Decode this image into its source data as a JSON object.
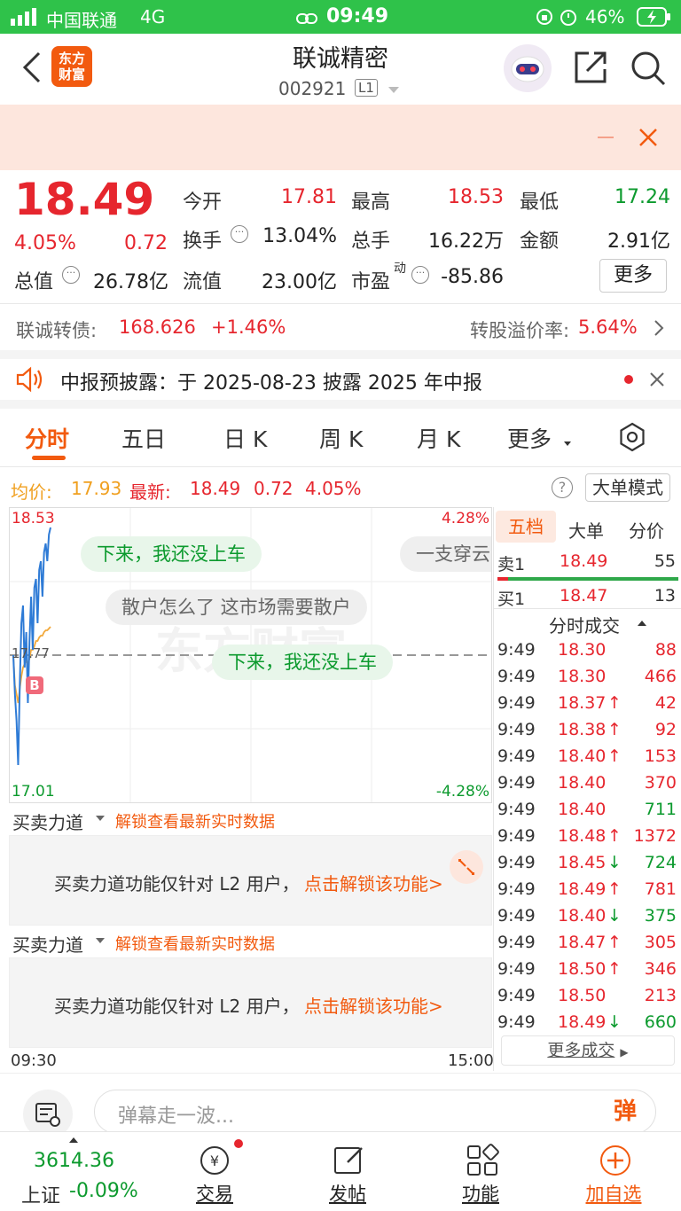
{
  "status": {
    "carrier": "中国联通",
    "network": "4G",
    "time": "09:49",
    "battery": "46%"
  },
  "nav": {
    "title": "联诚精密",
    "code": "002921",
    "level": "L1",
    "logo_line1": "东方",
    "logo_line2": "财富"
  },
  "quote": {
    "price": "18.49",
    "pct": "4.05%",
    "chg": "0.72",
    "row1": [
      {
        "label": "今开",
        "value": "17.81",
        "color": "red"
      },
      {
        "label": "最高",
        "value": "18.53",
        "color": "red"
      },
      {
        "label": "最低",
        "value": "17.24",
        "color": "green"
      }
    ],
    "row2": [
      {
        "label": "换手",
        "value": "13.04%"
      },
      {
        "label": "总手",
        "value": "16.22万"
      },
      {
        "label": "金额",
        "value": "2.91亿"
      }
    ],
    "row3": [
      {
        "label": "总值",
        "value": "26.78亿"
      },
      {
        "label": "流值",
        "value": "23.00亿"
      },
      {
        "label": "市盈",
        "sup": "动",
        "value": "-85.86"
      }
    ],
    "more": "更多"
  },
  "bond": {
    "label": "联诚转债:",
    "price": "168.626",
    "pct": "+1.46%",
    "premium_label": "转股溢价率:",
    "premium": "5.64%"
  },
  "notice": {
    "text": "中报预披露：于 2025-08-23 披露 2025 年中报"
  },
  "tabs": [
    "分时",
    "五日",
    "日 K",
    "周 K",
    "月 K",
    "更多"
  ],
  "chart_info": {
    "avg_label": "均价:",
    "avg": "17.93",
    "latest_label": "最新:",
    "latest": "18.49",
    "chg": "0.72",
    "pct": "4.05%",
    "mode": "大单模式"
  },
  "chart_data": {
    "type": "line",
    "ylim": [
      17.01,
      18.53
    ],
    "prev_close": 17.77,
    "y_top_label": "18.53",
    "y_bottom_label": "17.01",
    "y_mid_label": "17.77",
    "pct_top": "4.28%",
    "pct_bottom": "-4.28%",
    "x_start": "09:30",
    "x_end": "15:00",
    "price": [
      17.77,
      17.55,
      17.4,
      17.15,
      17.6,
      17.95,
      18.05,
      17.7,
      17.9,
      17.5,
      17.85,
      18.1,
      17.8,
      18.15,
      18.2,
      17.95,
      18.25,
      18.3,
      18.1,
      18.35,
      18.4,
      18.3,
      18.45,
      18.49
    ],
    "avg": [
      17.77,
      17.6,
      17.55,
      17.5,
      17.58,
      17.65,
      17.7,
      17.72,
      17.74,
      17.72,
      17.75,
      17.8,
      17.8,
      17.82,
      17.85,
      17.85,
      17.87,
      17.88,
      17.88,
      17.9,
      17.91,
      17.91,
      17.92,
      17.93
    ]
  },
  "bubbles": [
    "下来，我还没上车",
    "一支穿云",
    "散户怎么了 这市场需要散户",
    "下来，我还没上车"
  ],
  "l2": {
    "title": "买卖力道",
    "unlock": "解锁查看最新实时数据",
    "msg": "买卖力道功能仅针对 L2 用户，",
    "action": "点击解锁该功能>"
  },
  "right_tabs": [
    "五档",
    "大单",
    "分价"
  ],
  "order": [
    {
      "label": "卖1",
      "price": "18.49",
      "vol": "55"
    },
    {
      "label": "买1",
      "price": "18.47",
      "vol": "13"
    }
  ],
  "ticks_title": "分时成交",
  "ticks": [
    {
      "t": "9:49",
      "p": "18.30",
      "a": "",
      "v": "88",
      "vc": "red"
    },
    {
      "t": "9:49",
      "p": "18.30",
      "a": "",
      "v": "466",
      "vc": "red"
    },
    {
      "t": "9:49",
      "p": "18.37",
      "a": "↑",
      "v": "42",
      "vc": "red"
    },
    {
      "t": "9:49",
      "p": "18.38",
      "a": "↑",
      "v": "92",
      "vc": "red"
    },
    {
      "t": "9:49",
      "p": "18.40",
      "a": "↑",
      "v": "153",
      "vc": "red"
    },
    {
      "t": "9:49",
      "p": "18.40",
      "a": "",
      "v": "370",
      "vc": "red"
    },
    {
      "t": "9:49",
      "p": "18.40",
      "a": "",
      "v": "711",
      "vc": "green"
    },
    {
      "t": "9:49",
      "p": "18.48",
      "a": "↑",
      "v": "1372",
      "vc": "red"
    },
    {
      "t": "9:49",
      "p": "18.45",
      "a": "↓",
      "v": "724",
      "vc": "green"
    },
    {
      "t": "9:49",
      "p": "18.49",
      "a": "↑",
      "v": "781",
      "vc": "red"
    },
    {
      "t": "9:49",
      "p": "18.40",
      "a": "↓",
      "v": "375",
      "vc": "green"
    },
    {
      "t": "9:49",
      "p": "18.47",
      "a": "↑",
      "v": "305",
      "vc": "red"
    },
    {
      "t": "9:49",
      "p": "18.50",
      "a": "↑",
      "v": "346",
      "vc": "red"
    },
    {
      "t": "9:49",
      "p": "18.50",
      "a": "",
      "v": "213",
      "vc": "red"
    },
    {
      "t": "9:49",
      "p": "18.49",
      "a": "↓",
      "v": "660",
      "vc": "green"
    }
  ],
  "more_ticks": "更多成交",
  "danmu": {
    "placeholder": "弹幕走一波...",
    "btn": "弹"
  },
  "bottom": {
    "index": "3614.36",
    "index_name": "上证",
    "index_pct": "-0.09%",
    "items": [
      "交易",
      "发帖",
      "功能",
      "加自选"
    ]
  }
}
